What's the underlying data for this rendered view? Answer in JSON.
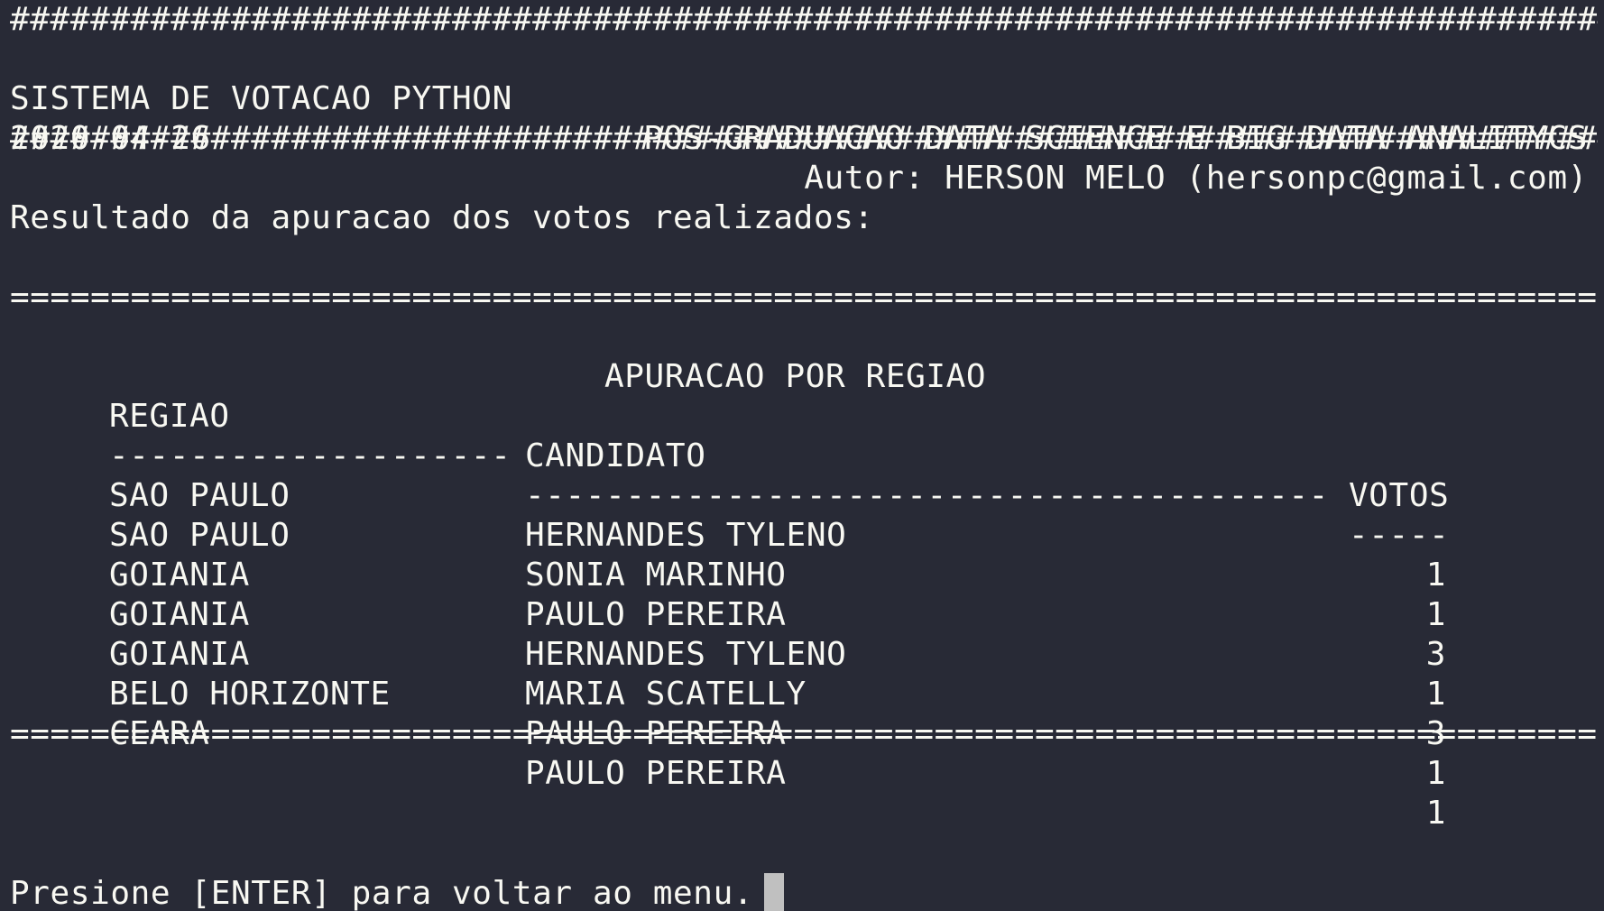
{
  "header": {
    "border": "########################################################################################",
    "app_title": "SISTEMA DE VOTACAO PYTHON",
    "course": "POS-GRADUACAO DATA SCIENCE E BIG DATA ANALITYCS",
    "date": "2020-04-26",
    "author": "Autor: HERSON MELO (hersonpc@gmail.com)"
  },
  "result_heading": "Resultado da apuracao dos votos realizados:",
  "table": {
    "rule": "========================================================================================",
    "title": "APURACAO POR REGIAO",
    "columns": {
      "region": "REGIAO",
      "candidate": "CANDIDATO",
      "votes": "VOTOS"
    },
    "underline": {
      "region": "--------------------",
      "candidate": "----------------------------------------",
      "votes": "-----"
    },
    "rows": [
      {
        "region": "SAO PAULO",
        "candidate": "HERNANDES TYLENO",
        "votes": "1"
      },
      {
        "region": "SAO PAULO",
        "candidate": "SONIA MARINHO",
        "votes": "1"
      },
      {
        "region": "GOIANIA",
        "candidate": "PAULO PEREIRA",
        "votes": "3"
      },
      {
        "region": "GOIANIA",
        "candidate": "HERNANDES TYLENO",
        "votes": "1"
      },
      {
        "region": "GOIANIA",
        "candidate": "MARIA SCATELLY",
        "votes": "3"
      },
      {
        "region": "BELO HORIZONTE",
        "candidate": "PAULO PEREIRA",
        "votes": "1"
      },
      {
        "region": "CEARA",
        "candidate": "PAULO PEREIRA",
        "votes": "1"
      }
    ]
  },
  "prompt": "Presione [ENTER] para voltar ao menu.",
  "colors": {
    "background": "#282a36",
    "foreground": "#f8f8f2",
    "cursor": "#c0c0c0"
  }
}
